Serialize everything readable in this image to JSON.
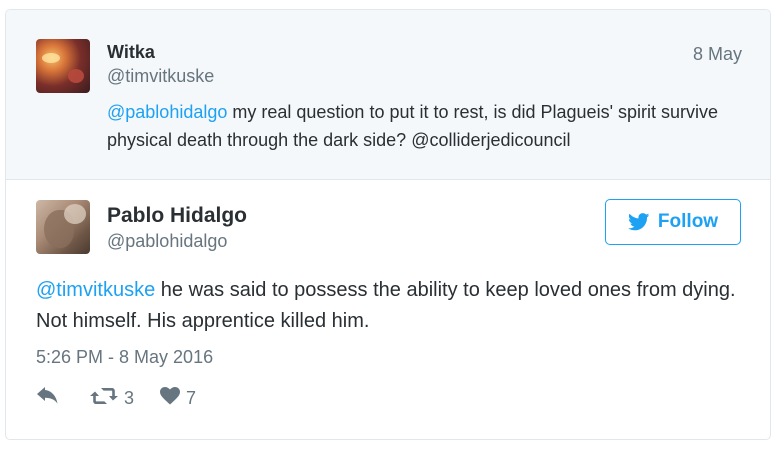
{
  "parent_tweet": {
    "name": "Witka",
    "handle": "@timvitkuske",
    "date": "8 May",
    "mention": "@pablohidalgo",
    "text_1": " my real question to put it to rest, is did Plagueis' spirit survive physical death through the dark side? ",
    "mention_2": "@colliderjedicouncil"
  },
  "tweet": {
    "name": "Pablo Hidalgo",
    "handle": "@pablohidalgo",
    "follow_label": "Follow",
    "mention": "@timvitkuske",
    "text": " he was said to possess the ability to keep loved ones from dying. Not himself. His apprentice killed him.",
    "timestamp": "5:26 PM - 8 May 2016",
    "retweets": "3",
    "likes": "7"
  },
  "colors": {
    "accent": "#1da1f2",
    "muted": "#66757f",
    "text": "#292f33",
    "parent_bg": "#f5f8fa",
    "border": "#e1e8ed"
  },
  "icons": [
    "twitter-bird-icon",
    "reply-icon",
    "retweet-icon",
    "heart-icon"
  ]
}
